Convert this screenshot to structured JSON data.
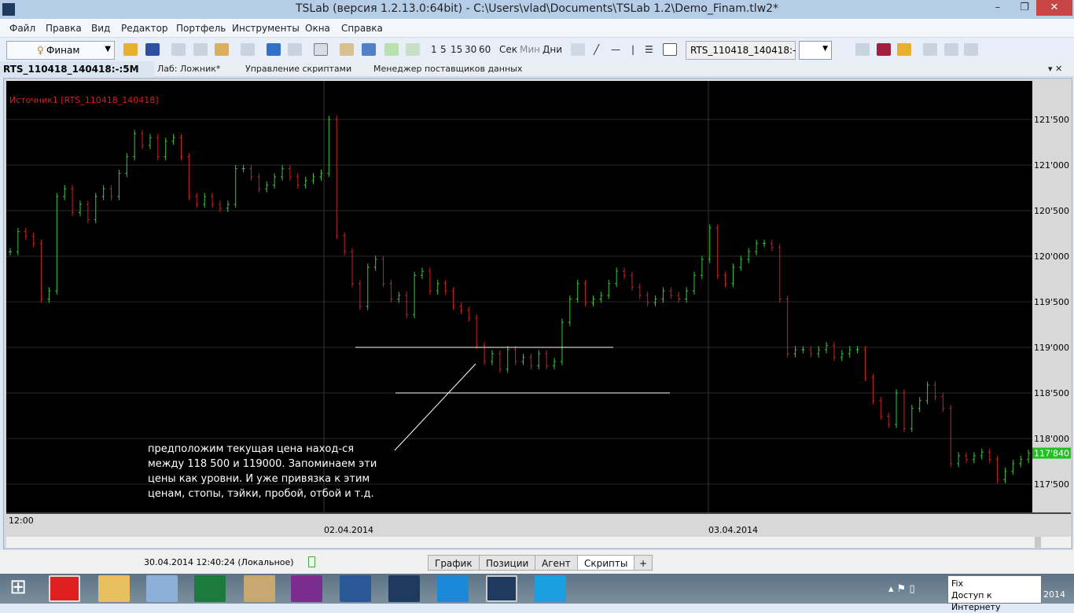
{
  "window": {
    "title": "TSLab (версия 1.2.13.0:64bit) - C:\\Users\\vlad\\Documents\\TSLab 1.2\\Demo_Finam.tlw2*",
    "minimize": "–",
    "restore": "❐",
    "close": "✕"
  },
  "menu": [
    "Файл",
    "Правка",
    "Вид",
    "Редактор",
    "Портфель",
    "Инструменты",
    "Окна",
    "Справка"
  ],
  "toolbar": {
    "broker": "Финам",
    "intervals": [
      "1",
      "5",
      "15",
      "30",
      "60"
    ],
    "units": [
      "Сек",
      "Мин",
      "Дни"
    ],
    "symbol": "RTS_110418_140418:-"
  },
  "tabs": [
    {
      "label": "RTS_110418_140418:-:5M",
      "active": true
    },
    {
      "label": "Лаб: Ложник*"
    },
    {
      "label": "Управление скриптами"
    },
    {
      "label": "Менеджер поставщиков данных"
    }
  ],
  "chart_data": {
    "type": "bar",
    "legend": "Источник1 [RTS_110418_140418]",
    "ylim": [
      117200,
      121950
    ],
    "yticks": [
      "121'500",
      "121'000",
      "120'500",
      "120'000",
      "119'500",
      "119'000",
      "118'500",
      "118'000",
      "117'500"
    ],
    "ytick_values": [
      121500,
      121000,
      120500,
      120000,
      119500,
      119000,
      118500,
      118000,
      117500
    ],
    "last_price": "117'840",
    "xticks": [
      "12:00",
      "02.04.2014",
      "03.04.2014"
    ],
    "closes": [
      120050,
      120270,
      120220,
      120140,
      119530,
      119620,
      120655,
      120740,
      120480,
      120570,
      120400,
      120655,
      120740,
      120655,
      120910,
      121090,
      121345,
      121215,
      121300,
      121090,
      121260,
      121300,
      121090,
      120655,
      120570,
      120655,
      120570,
      120525,
      120570,
      120960,
      120960,
      120870,
      120740,
      120780,
      120870,
      120960,
      120870,
      120780,
      120830,
      120870,
      120910,
      121500,
      120225,
      120050,
      119700,
      119450,
      119880,
      119965,
      119700,
      119530,
      119570,
      119360,
      119790,
      119835,
      119620,
      119700,
      119620,
      119450,
      119405,
      119320,
      119020,
      118845,
      118930,
      118760,
      118975,
      118845,
      118890,
      118800,
      118930,
      118800,
      118845,
      119275,
      119530,
      119700,
      119490,
      119530,
      119570,
      119700,
      119835,
      119790,
      119660,
      119570,
      119490,
      119530,
      119620,
      119570,
      119530,
      119620,
      119790,
      119965,
      120310,
      119790,
      119700,
      119880,
      119965,
      120050,
      120140,
      120140,
      120095,
      119530,
      118930,
      118975,
      118975,
      118930,
      118975,
      119020,
      118890,
      118930,
      118975,
      118975,
      118670,
      118415,
      118245,
      118155,
      118500,
      118110,
      118330,
      118415,
      118585,
      118460,
      118330,
      117725,
      117810,
      117770,
      117810,
      117850,
      117770,
      117550,
      117640,
      117725,
      117770,
      117840
    ],
    "levels": [
      119000,
      118500
    ],
    "annotation": "предположим  текущая цена наход-ся между 118 500 и 119000. Запоминаем эти цены как уровни. И уже привязка к этим ценам, стопы, тэйки, пробой, отбой и т.д.",
    "colors": {
      "up": "#3cc83c",
      "down": "#d02020",
      "level": "#ffffff",
      "legend": "#d42020",
      "last": "#22c022"
    }
  },
  "status": {
    "datetime": "30.04.2014 12:40:24 (Локальное)"
  },
  "bottom_tabs": [
    "График",
    "Позиции",
    "Агент",
    "Скрипты",
    "+"
  ],
  "tray": {
    "tooltip_line1": "Fix",
    "tooltip_line2": "Доступ к Интернету",
    "clock_tail": "2014"
  }
}
